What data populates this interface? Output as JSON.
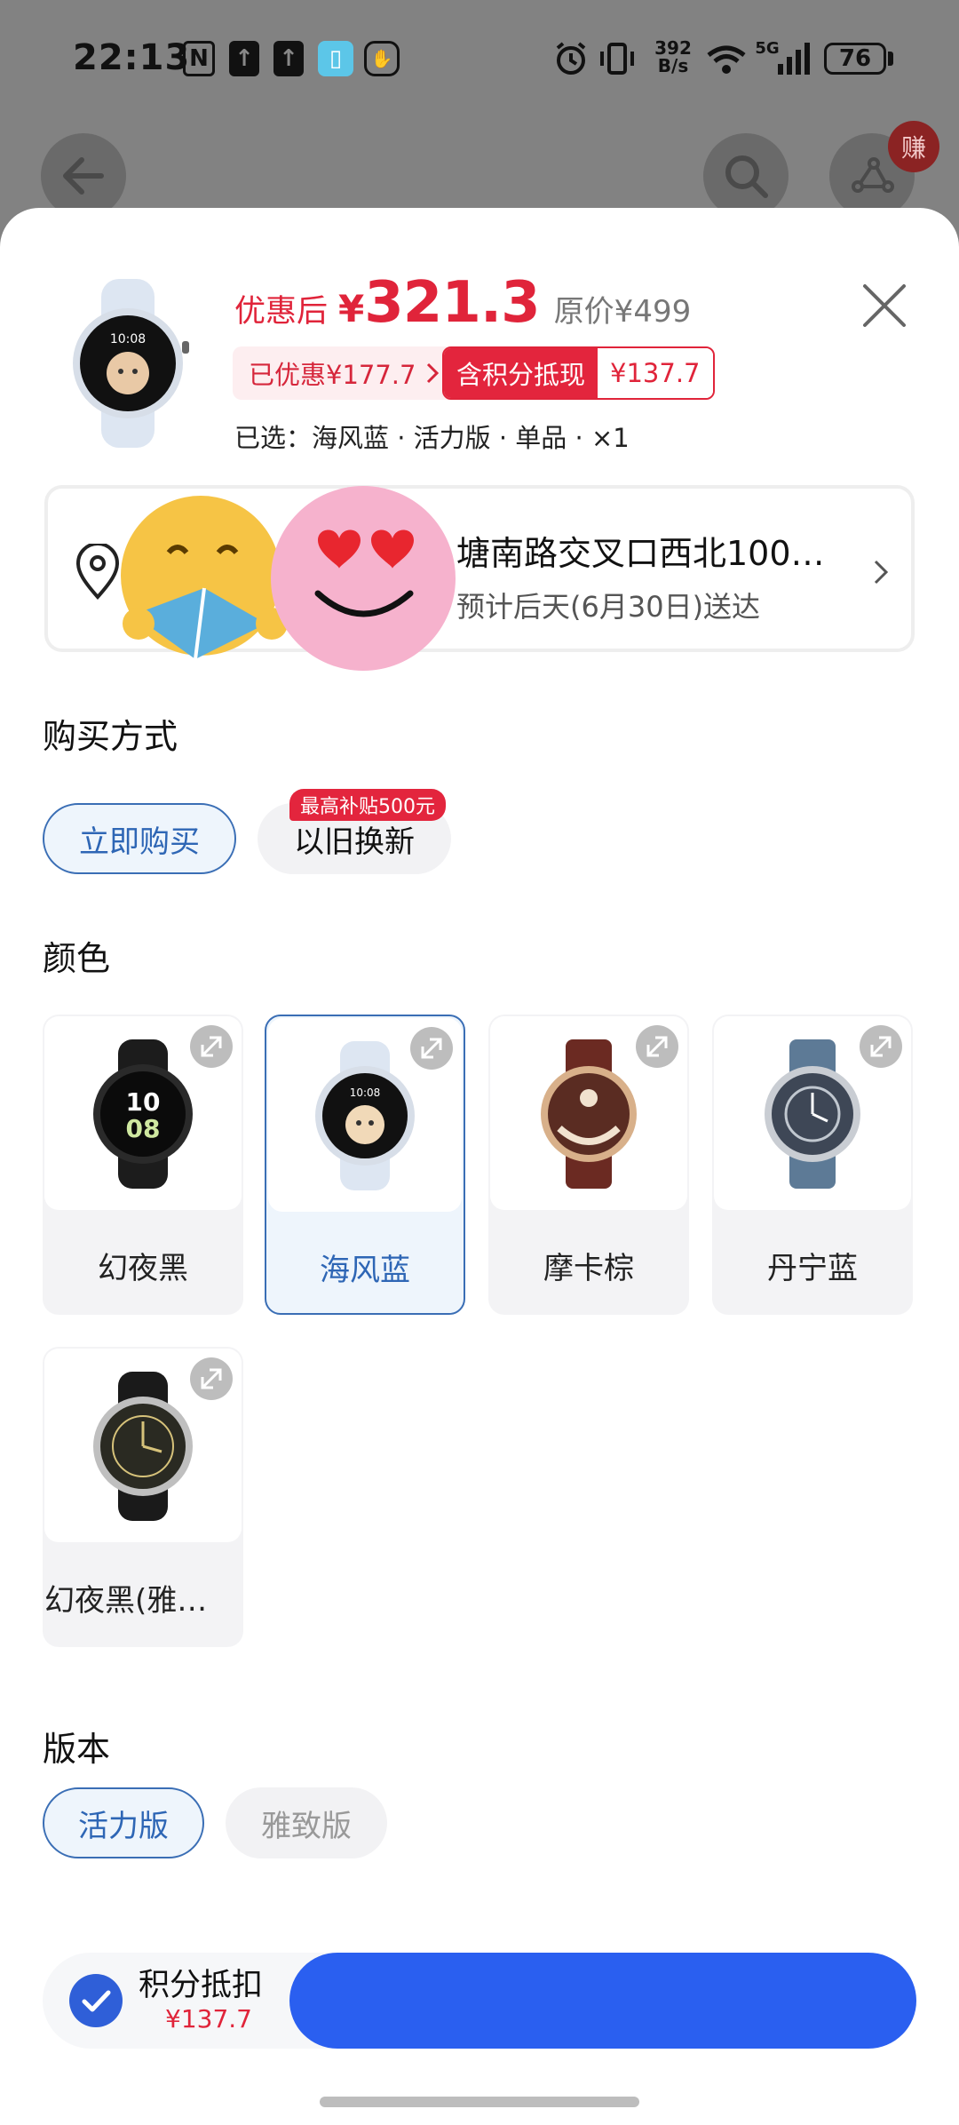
{
  "status_bar": {
    "time": "22:13",
    "net_speed_value": "392",
    "net_speed_unit": "B/s",
    "network": "5G",
    "battery": "76",
    "icons": [
      "nfc-icon",
      "upload-icon",
      "upload-icon",
      "book-app-icon",
      "hand-icon",
      "alarm-icon",
      "vibrate-icon",
      "wifi-icon",
      "signal-icon",
      "battery-icon"
    ]
  },
  "background_nav": {
    "earn_badge": "赚",
    "icons": [
      "back-arrow-icon",
      "search-icon",
      "share-icon"
    ]
  },
  "product": {
    "price_label": "优惠后",
    "currency": "¥",
    "price": "321.3",
    "original_price": "原价¥499",
    "discount_chip": "已优惠¥177.7",
    "points_chip_label": "含积分抵现",
    "points_chip_value": "¥137.7",
    "selected": "已选：海风蓝 · 活力版 · 单品 · ×1"
  },
  "address": {
    "line1": "塘南路交叉口西北100…",
    "line2": "预计后天(6月30日)送达"
  },
  "purchase_method": {
    "title": "购买方式",
    "options": [
      "立即购买",
      "以旧换新"
    ],
    "selected_index": 0,
    "subsidy_tag": "最高补贴500元"
  },
  "colors": {
    "title": "颜色",
    "options": [
      {
        "name": "幻夜黑",
        "face": "#0b0b0b",
        "strap": "#1c1c1c",
        "bezel": "#2a2a2a",
        "accent": "#cfe8a0"
      },
      {
        "name": "海风蓝",
        "face": "#111111",
        "strap": "#dde6f2",
        "bezel": "#d7dee8",
        "accent": "#f1d9b8"
      },
      {
        "name": "摩卡棕",
        "face": "#5a2c22",
        "strap": "#6b2a22",
        "bezel": "#d8b08a",
        "accent": "#f1e2cf"
      },
      {
        "name": "丹宁蓝",
        "face": "#3e4756",
        "strap": "#5d7a96",
        "bezel": "#c9cdd3",
        "accent": "#c0c7cf"
      },
      {
        "name": "幻夜黑(雅…",
        "face": "#2a2a22",
        "strap": "#1a1a1a",
        "bezel": "#bfbfbf",
        "accent": "#d6c27a"
      }
    ],
    "selected_index": 1
  },
  "version": {
    "title": "版本",
    "options": [
      "活力版",
      "雅致版"
    ],
    "selected_index": 0
  },
  "bottom_bar": {
    "points_label": "积分抵扣",
    "points_value": "¥137.7"
  },
  "theme": {
    "price_red": "#e0243a",
    "primary_blue": "#2a5ff0",
    "selected_blue": "#2e66b5"
  }
}
